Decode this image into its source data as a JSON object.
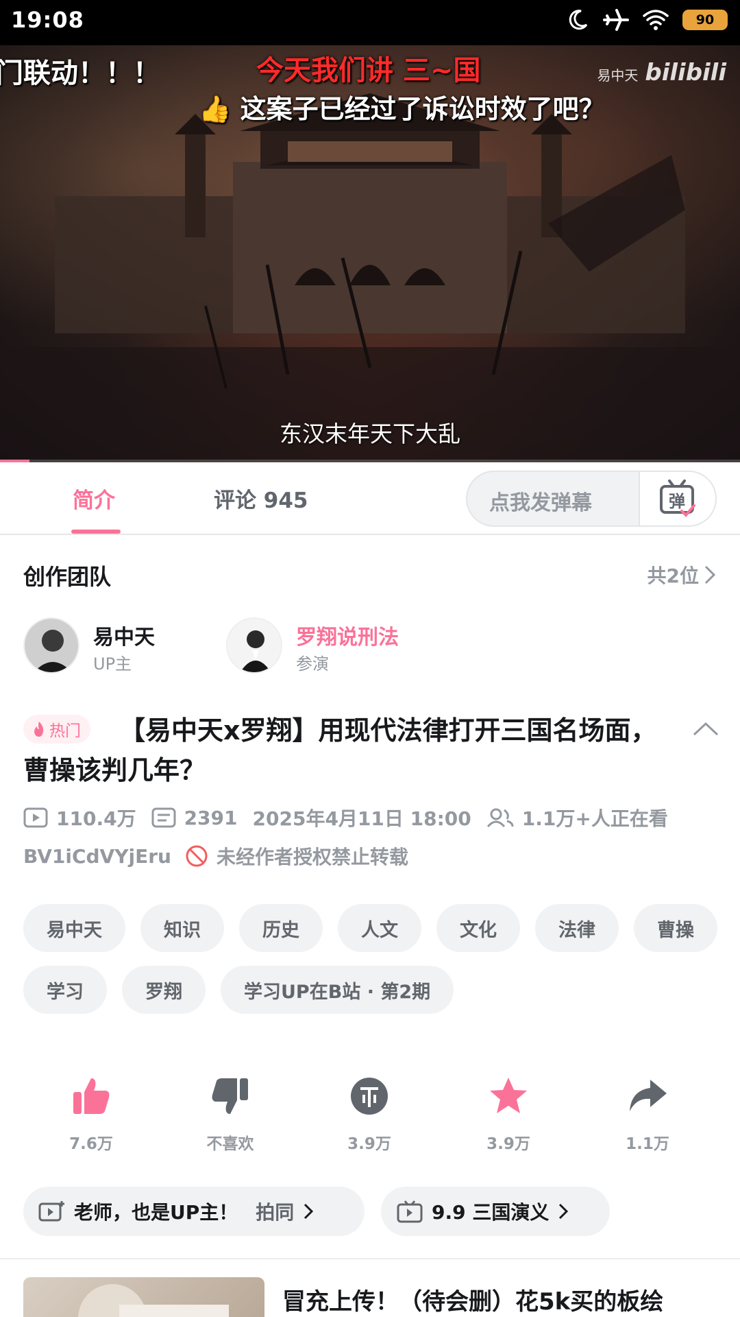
{
  "status_bar": {
    "time": "19:08",
    "battery": "90"
  },
  "video": {
    "danmaku": [
      "门联动！！！",
      "今天我们讲 三~国",
      "这案子已经过了诉讼时效了吧？"
    ],
    "watermark_name": "易中天",
    "watermark_logo": "bilibili",
    "subtitle": "东汉末年天下大乱",
    "progress": 0.04
  },
  "tabs": {
    "intro": "简介",
    "comments": "评论 945",
    "danmaku_placeholder": "点我发弹幕",
    "danmaku_button": "弹"
  },
  "team": {
    "title": "创作团队",
    "count": "共2位",
    "members": [
      {
        "name": "易中天",
        "role": "UP主"
      },
      {
        "name": "罗翔说刑法",
        "role": "参演"
      }
    ]
  },
  "video_info": {
    "hot_badge": "热门",
    "title": "【易中天x罗翔】用现代法律打开三国名场面，曹操该判几年？",
    "views": "110.4万",
    "danmaku_count": "2391",
    "date": "2025年4月11日  18:00",
    "watching": "1.1万+人正在看",
    "bvid": "BV1iCdVYjEru",
    "copyright": "未经作者授权禁止转载"
  },
  "tags": [
    "易中天",
    "知识",
    "历史",
    "人文",
    "文化",
    "法律",
    "曹操",
    "学习",
    "罗翔",
    "学习UP在B站 · 第2期"
  ],
  "actions": [
    {
      "name": "like",
      "label": "7.6万"
    },
    {
      "name": "dislike",
      "label": "不喜欢"
    },
    {
      "name": "coin",
      "label": "3.9万"
    },
    {
      "name": "favorite",
      "label": "3.9万"
    },
    {
      "name": "share",
      "label": "1.1万"
    }
  ],
  "chips": {
    "chip1_text": "老师，也是UP主！",
    "chip1_extra": "拍同",
    "chip2_text": "9.9  三国演义"
  },
  "recommendation": {
    "title": "冒充上传！（待会删）花5k买的板绘"
  },
  "colors": {
    "accent": "#fb7299",
    "muted": "#9499a0"
  }
}
